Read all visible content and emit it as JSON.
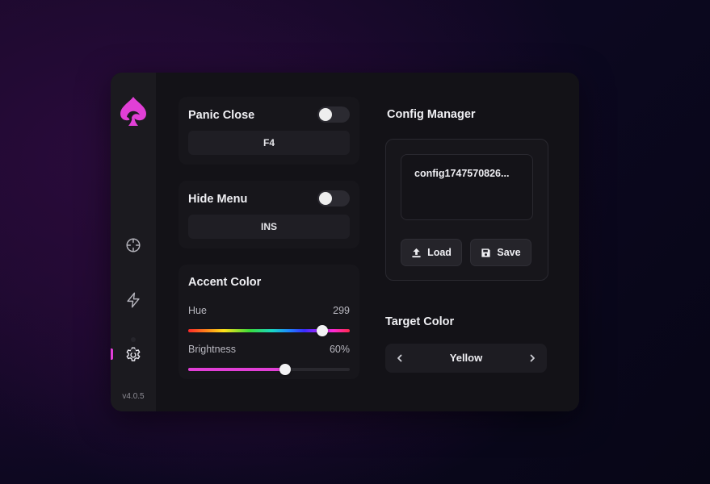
{
  "app": {
    "version": "v4.0.5",
    "accent_color": "#e13fd6"
  },
  "sidebar": {
    "items": [
      {
        "icon": "crosshair-icon",
        "active": false
      },
      {
        "icon": "lightning-icon",
        "active": false
      },
      {
        "icon": "gear-icon",
        "active": true
      }
    ]
  },
  "panic_close": {
    "label": "Panic Close",
    "enabled": false,
    "key": "F4"
  },
  "hide_menu": {
    "label": "Hide Menu",
    "enabled": false,
    "key": "INS"
  },
  "accent_color": {
    "title": "Accent Color",
    "hue": {
      "label": "Hue",
      "value": "299",
      "fraction": 0.83
    },
    "brightness": {
      "label": "Brightness",
      "value": "60%",
      "fraction": 0.6
    }
  },
  "config_manager": {
    "title": "Config Manager",
    "entries": [
      "config1747570826..."
    ],
    "load_label": "Load",
    "save_label": "Save"
  },
  "target_color": {
    "title": "Target Color",
    "value": "Yellow"
  }
}
